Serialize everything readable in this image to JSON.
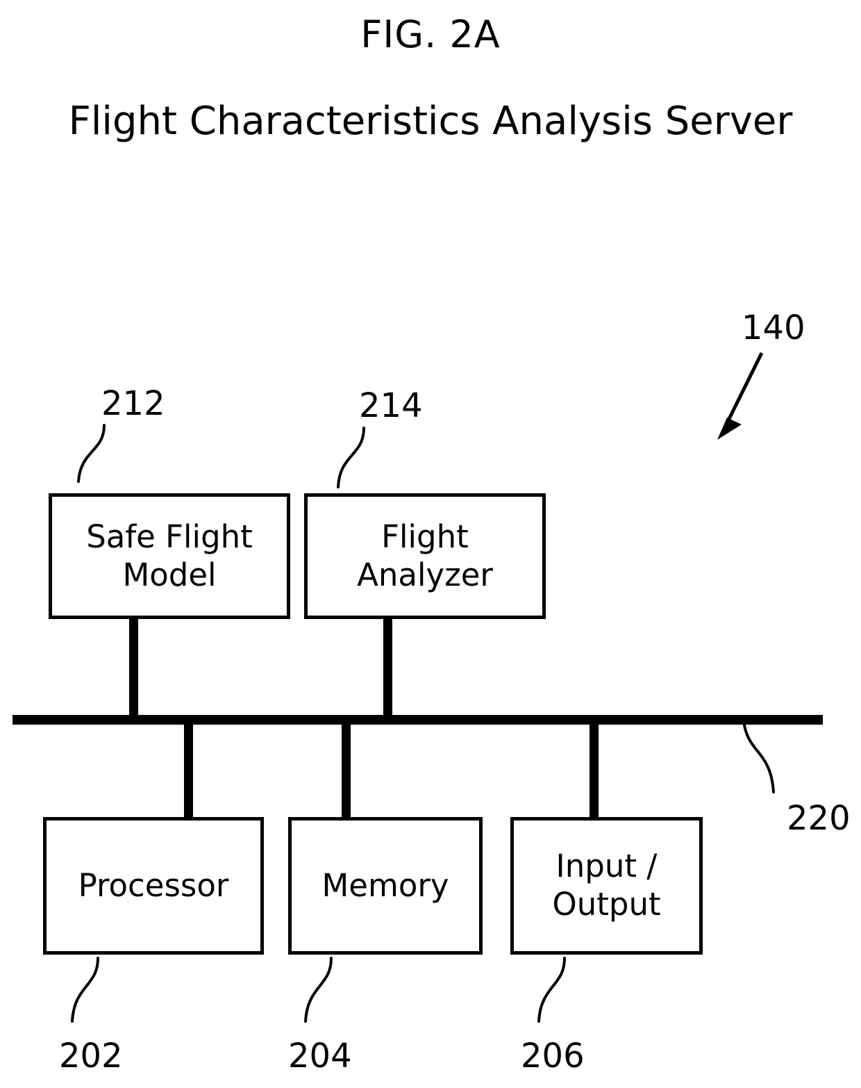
{
  "figure": {
    "title": "FIG. 2A",
    "subtitle": "Flight Characteristics Analysis Server",
    "system_ref": "140"
  },
  "upper_modules": [
    {
      "label": "Safe Flight\nModel",
      "ref": "212"
    },
    {
      "label": "Flight\nAnalyzer",
      "ref": "214"
    }
  ],
  "lower_modules": [
    {
      "label": "Processor",
      "ref": "202"
    },
    {
      "label": "Memory",
      "ref": "204"
    },
    {
      "label": "Input /\nOutput",
      "ref": "206"
    }
  ],
  "bus": {
    "ref": "220"
  },
  "colors": {
    "ink": "#000000",
    "paper": "#ffffff"
  }
}
